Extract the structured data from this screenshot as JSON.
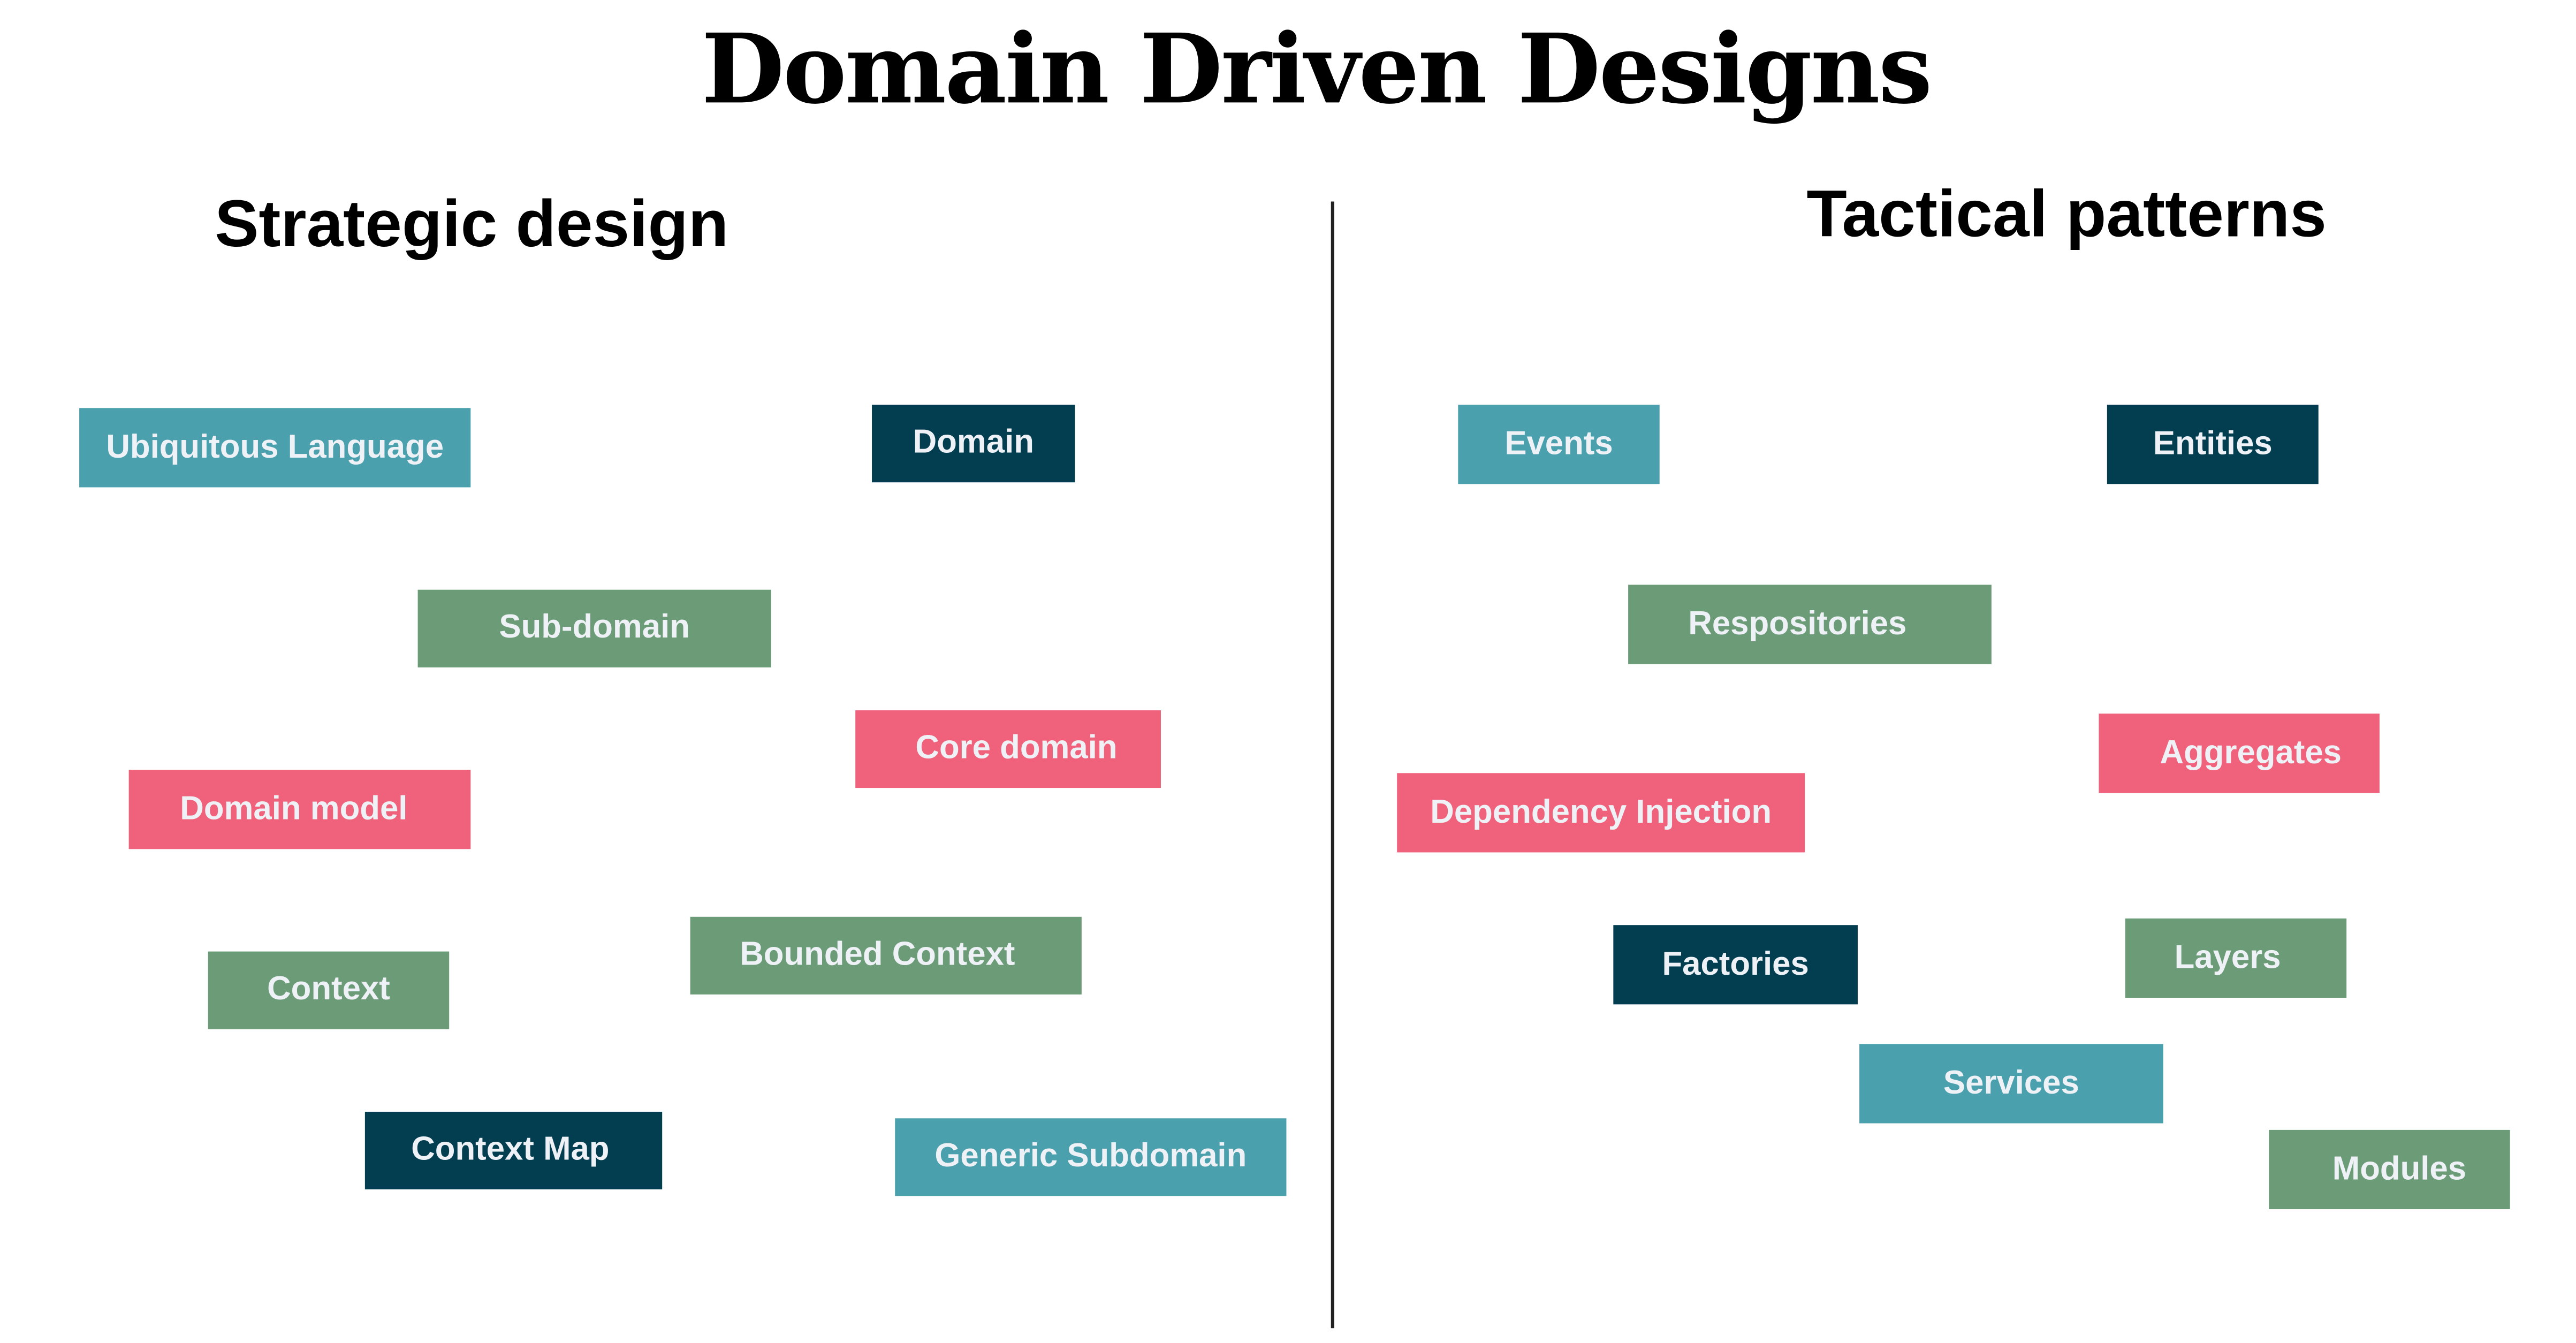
{
  "title": "Domain Driven Designs",
  "colors": {
    "teal": "#4aa0ad",
    "navy": "#033e50",
    "green": "#6b9c77",
    "pink": "#f0627b",
    "label_text": "#eef1f5"
  },
  "strategic": {
    "heading": "Strategic design",
    "items": [
      {
        "label": "Ubiquitous Language",
        "color": "teal"
      },
      {
        "label": "Domain",
        "color": "navy"
      },
      {
        "label": "Sub-domain",
        "color": "green"
      },
      {
        "label": "Core domain",
        "color": "pink"
      },
      {
        "label": "Domain model",
        "color": "pink"
      },
      {
        "label": "Bounded Context",
        "color": "green"
      },
      {
        "label": "Context",
        "color": "green"
      },
      {
        "label": "Context Map",
        "color": "navy"
      },
      {
        "label": "Generic Subdomain",
        "color": "teal"
      }
    ]
  },
  "tactical": {
    "heading": "Tactical patterns",
    "items": [
      {
        "label": "Events",
        "color": "teal"
      },
      {
        "label": "Entities",
        "color": "navy"
      },
      {
        "label": "Respositories",
        "color": "green"
      },
      {
        "label": "Aggregates",
        "color": "pink"
      },
      {
        "label": "Dependency Injection",
        "color": "pink"
      },
      {
        "label": "Factories",
        "color": "navy"
      },
      {
        "label": "Layers",
        "color": "green"
      },
      {
        "label": "Services",
        "color": "teal"
      },
      {
        "label": "Modules",
        "color": "green"
      }
    ]
  }
}
